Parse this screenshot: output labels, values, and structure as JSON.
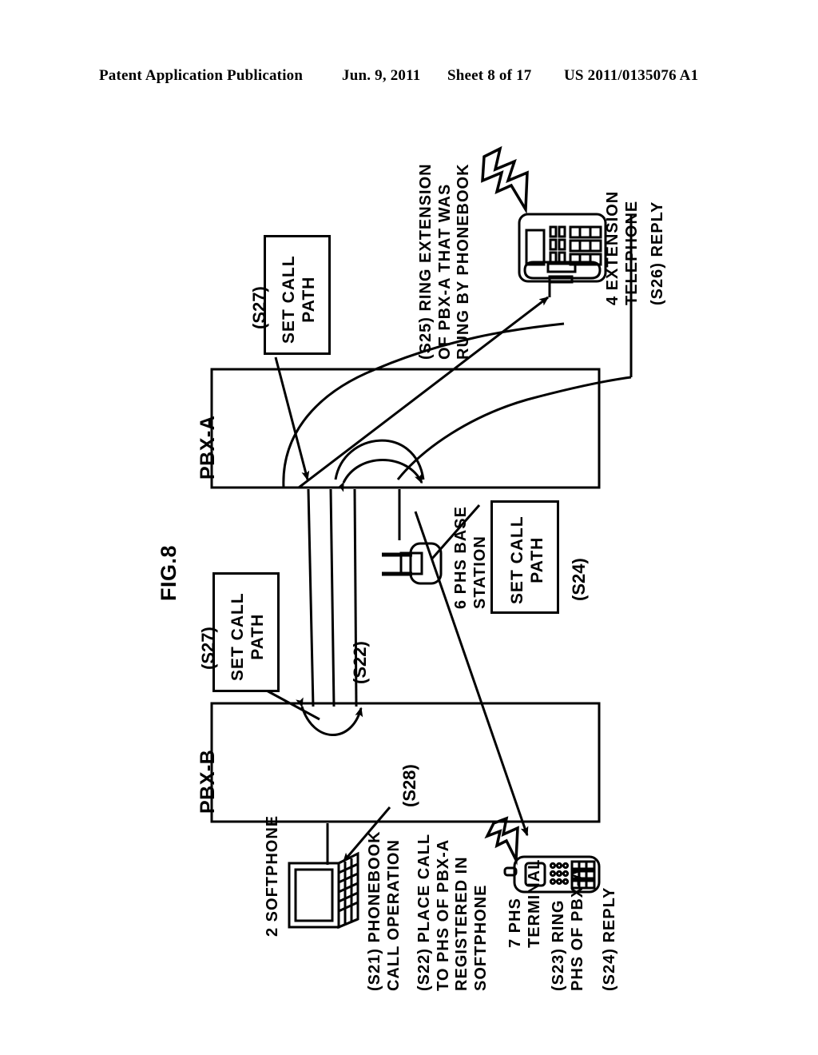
{
  "header": {
    "publication": "Patent Application Publication",
    "date": "Jun. 9, 2011",
    "sheet": "Sheet 8 of 17",
    "number": "US 2011/0135076 A1"
  },
  "figure": {
    "label": "FIG.8",
    "nodes": {
      "pbx_a": "PBX-A",
      "pbx_b": "PBX-B",
      "extension_telephone": "4 EXTENSION\nTELEPHONE",
      "phs_base_station": "6 PHS BASE\nSTATION",
      "phs_terminal": "7 PHS\nTERMINAL",
      "softphone": "2 SOFTPHONE"
    },
    "boxes": [
      {
        "id": "set-call-path-s27-a",
        "tag": "(S27)",
        "text": "SET CALL\nPATH"
      },
      {
        "id": "set-call-path-s24",
        "tag": "(S24)",
        "text": "SET CALL\nPATH"
      },
      {
        "id": "set-call-path-s27-b",
        "tag": "(S27)",
        "text": "SET CALL\nPATH"
      }
    ],
    "annotations": {
      "s25": "(S25) RING EXTENSION\nOF PBX-A THAT WAS\nRUNG BY PHONEBOOK",
      "s26": "(S26) REPLY",
      "s22_arrow": "(S22)",
      "s28": "(S28)",
      "s21": "(S21) PHONEBOOK\nCALL OPERATION",
      "s22": "(S22) PLACE CALL\nTO PHS OF PBX-A\nREGISTERED IN\nSOFTPHONE",
      "s23": "(S23) RING\nPHS OF PBX-A",
      "s24_reply": "(S24) REPLY"
    },
    "icons": {
      "lightning_top": "lightning-bolt-icon",
      "lightning_bottom": "lightning-bolt-icon",
      "desk_phone": "desk-telephone-icon",
      "base_station": "base-station-icon",
      "mobile_phone": "phs-handset-icon",
      "laptop": "laptop-icon"
    },
    "colors": {
      "ink": "#000000",
      "paper": "#ffffff"
    }
  }
}
